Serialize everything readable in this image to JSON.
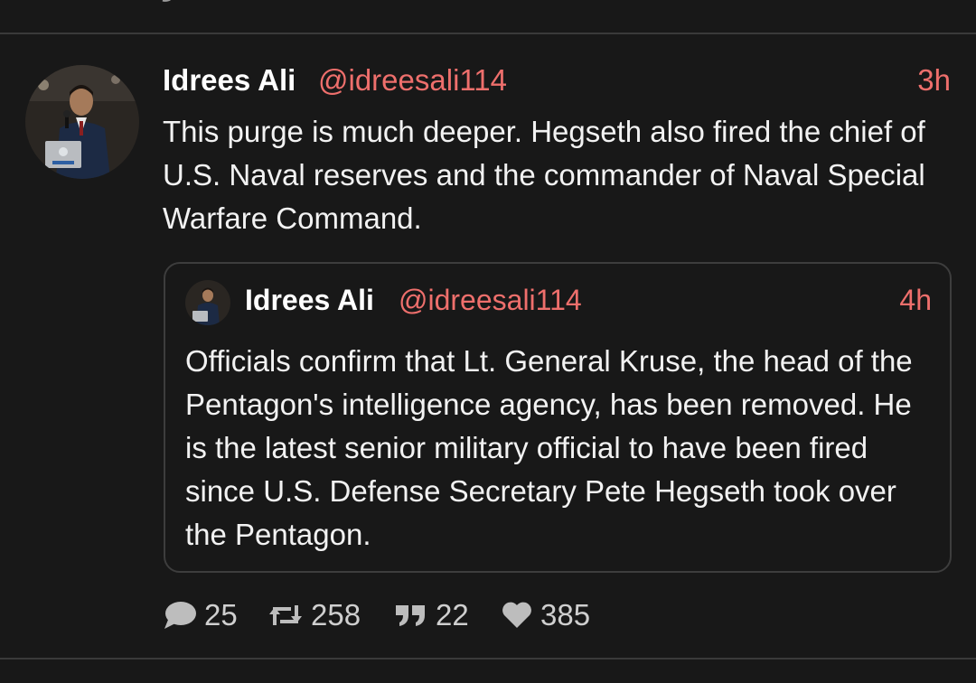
{
  "post": {
    "author_name": "Idrees Ali",
    "handle": "@idreesali114",
    "time": "3h",
    "text": "This purge is much deeper. Hegseth also fired the chief of U.S. Naval reserves and the commander of Naval Special Warfare Command."
  },
  "quoted": {
    "author_name": "Idrees Ali",
    "handle": "@idreesali114",
    "time": "4h",
    "text": "Officials confirm that Lt. General Kruse, the head of the Pentagon's intelligence agency, has been removed. He is the latest senior military official to have been fired since U.S. Defense Secretary Pete Hegseth took over the Pentagon."
  },
  "actions": {
    "replies": "25",
    "reposts": "258",
    "quotes": "22",
    "likes": "385"
  },
  "icons": {
    "reply": "speech-bubble-icon",
    "repost": "retweet-icon",
    "quote": "quote-marks-icon",
    "like": "heart-icon"
  },
  "colors": {
    "background": "#181818",
    "accent": "#ee6f6c",
    "text": "#f2f2f2",
    "border": "#3d3d3d",
    "icon": "#bdbdbd"
  }
}
